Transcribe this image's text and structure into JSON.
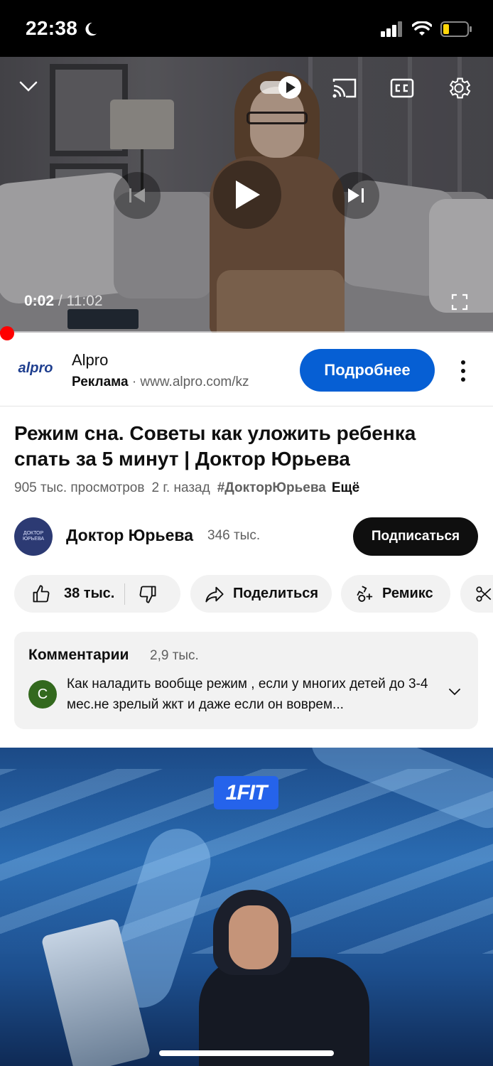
{
  "status_bar": {
    "time": "22:38"
  },
  "player": {
    "current_time": "0:02",
    "separator": " / ",
    "duration": "11:02",
    "progress_fraction": 0.003,
    "icons": [
      "chevron-down-icon",
      "autoplay-toggle-icon",
      "cast-icon",
      "captions-icon",
      "settings-icon",
      "previous-icon",
      "play-icon",
      "next-icon",
      "fullscreen-icon"
    ]
  },
  "ad": {
    "logo_text": "alpro",
    "title": "Alpro",
    "label": "Реклама",
    "dot": "·",
    "url": "www.alpro.com/kz",
    "cta": "Подробнее"
  },
  "video": {
    "title": "Режим сна. Советы как уложить ребенка спать за 5 минут | Доктор Юрьева",
    "views": "905 тыс. просмотров",
    "ago": "2 г. назад",
    "hashtag": "#ДокторЮрьева",
    "more": "Ещё"
  },
  "channel": {
    "avatar_text": "ДОКТОР ЮРЬЕВА",
    "name": "Доктор Юрьева",
    "subscribers": "346 тыс.",
    "subscribe_label": "Подписаться"
  },
  "actions": {
    "likes": "38 тыс.",
    "share": "Поделиться",
    "remix": "Ремикс"
  },
  "comments": {
    "title": "Комментарии",
    "count": "2,9 тыс.",
    "avatar_letter": "С",
    "preview": "Как наладить вообще режим , если у многих детей до 3-4 мес.не зрелый жкт и даже если он воврем..."
  },
  "promo": {
    "logo": "1FIT"
  },
  "colors": {
    "accent_blue": "#065fd4",
    "progress_red": "#ff0000",
    "chip_bg": "#f2f2f2",
    "comment_avatar": "#33691e"
  }
}
